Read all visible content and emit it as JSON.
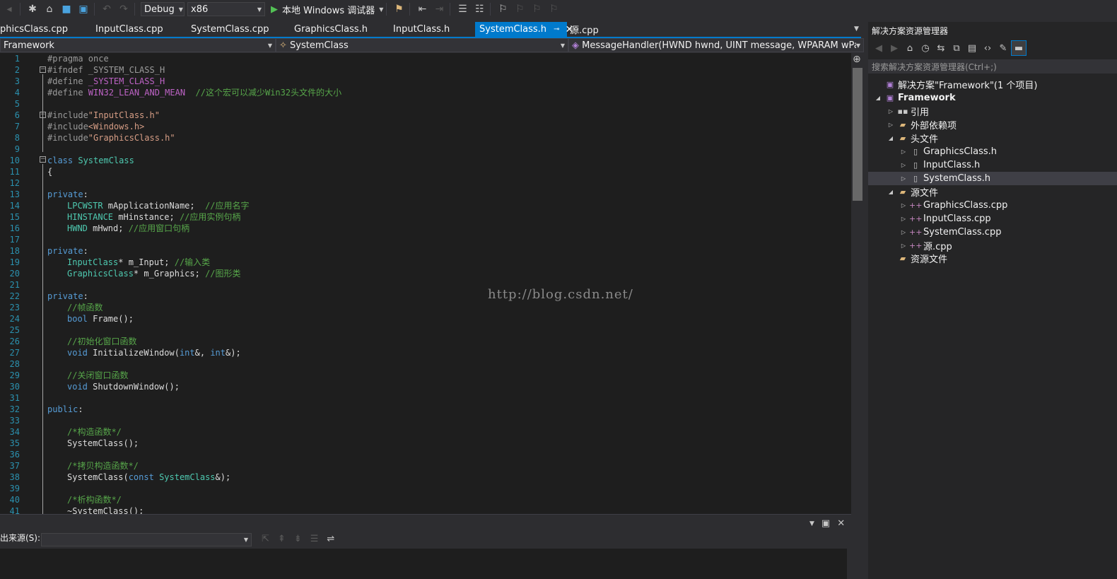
{
  "toolbar": {
    "config": "Debug",
    "platform": "x86",
    "run_label": "本地 Windows 调试器"
  },
  "tabs": [
    {
      "label": "phicsClass.cpp"
    },
    {
      "label": "InputClass.cpp"
    },
    {
      "label": "SystemClass.cpp"
    },
    {
      "label": "GraphicsClass.h"
    },
    {
      "label": "InputClass.h"
    },
    {
      "label": "SystemClass.h"
    },
    {
      "label": "源.cpp"
    }
  ],
  "navbar": {
    "project": "Framework",
    "class": "SystemClass",
    "member": "MessageHandler(HWND hwnd, UINT message, WPARAM wParam"
  },
  "code": {
    "line_numbers": [
      "1",
      "2",
      "3",
      "4",
      "5",
      "6",
      "7",
      "8",
      "9",
      "10",
      "11",
      "12",
      "13",
      "14",
      "15",
      "16",
      "17",
      "18",
      "19",
      "20",
      "21",
      "22",
      "23",
      "24",
      "25",
      "26",
      "27",
      "28",
      "29",
      "30",
      "31",
      "32",
      "33",
      "34",
      "35",
      "36",
      "37",
      "38",
      "39",
      "40",
      "41"
    ],
    "lines": {
      "l1_pp": "#pragma once",
      "l2_pp": "#ifndef _SYSTEM_CLASS_H",
      "l3_pp": "#define ",
      "l3_mac": "_SYSTEM_CLASS_H",
      "l4_pp": "#define ",
      "l4_mac": "WIN32_LEAN_AND_MEAN",
      "l4_cm": "//这个宏可以减少Win32头文件的大小",
      "l6_pp": "#include",
      "l6_str": "\"InputClass.h\"",
      "l7_pp": "#include",
      "l7_str": "<Windows.h>",
      "l8_pp": "#include",
      "l8_str": "\"GraphicsClass.h\"",
      "l10_kw": "class ",
      "l10_ty": "SystemClass",
      "l11": "{",
      "l13_kw": "private",
      "l13_p": ":",
      "l14_ty": "LPCWSTR",
      "l14_t": " mApplicationName;  ",
      "l14_cm": "//应用名字",
      "l15_ty": "HINSTANCE",
      "l15_t": " mHinstance; ",
      "l15_cm": "//应用实例句柄",
      "l16_ty": "HWND",
      "l16_t": " mHwnd; ",
      "l16_cm": "//应用窗口句柄",
      "l18_kw": "private",
      "l18_p": ":",
      "l19_ty": "InputClass",
      "l19_t": "* m_Input; ",
      "l19_cm": "//输入类",
      "l20_ty": "GraphicsClass",
      "l20_t": "* m_Graphics; ",
      "l20_cm": "//图形类",
      "l22_kw": "private",
      "l22_p": ":",
      "l23_cm": "//帧函数",
      "l24_kw": "bool",
      "l24_t": " Frame();",
      "l26_cm": "//初始化窗口函数",
      "l27_kw": "void",
      "l27_t1": " InitializeWindow(",
      "l27_kw2": "int",
      "l27_t2": "&, ",
      "l27_kw3": "int",
      "l27_t3": "&);",
      "l29_cm": "//关闭窗口函数",
      "l30_kw": "void",
      "l30_t": " ShutdownWindow();",
      "l32_kw": "public",
      "l32_p": ":",
      "l34_cm": "/*构造函数*/",
      "l35": "SystemClass();",
      "l37_cm": "/*拷贝构造函数*/",
      "l38_t1": "SystemClass(",
      "l38_kw": "const ",
      "l38_ty": "SystemClass",
      "l38_t2": "&);",
      "l40_cm": "/*析构函数*/",
      "l41": "~SystemClass();"
    }
  },
  "watermark": "http://blog.csdn.net/",
  "output": {
    "source_label": "出来源(S):"
  },
  "solution_explorer": {
    "title": "解决方案资源管理器",
    "search_placeholder": "搜索解决方案资源管理器(Ctrl+;)",
    "solution": "解决方案\"Framework\"(1 个项目)",
    "project": "Framework",
    "references": "引用",
    "external_deps": "外部依赖项",
    "headers_folder": "头文件",
    "headers": [
      "GraphicsClass.h",
      "InputClass.h",
      "SystemClass.h"
    ],
    "sources_folder": "源文件",
    "sources": [
      "GraphicsClass.cpp",
      "InputClass.cpp",
      "SystemClass.cpp",
      "源.cpp"
    ],
    "resources_folder": "资源文件"
  }
}
